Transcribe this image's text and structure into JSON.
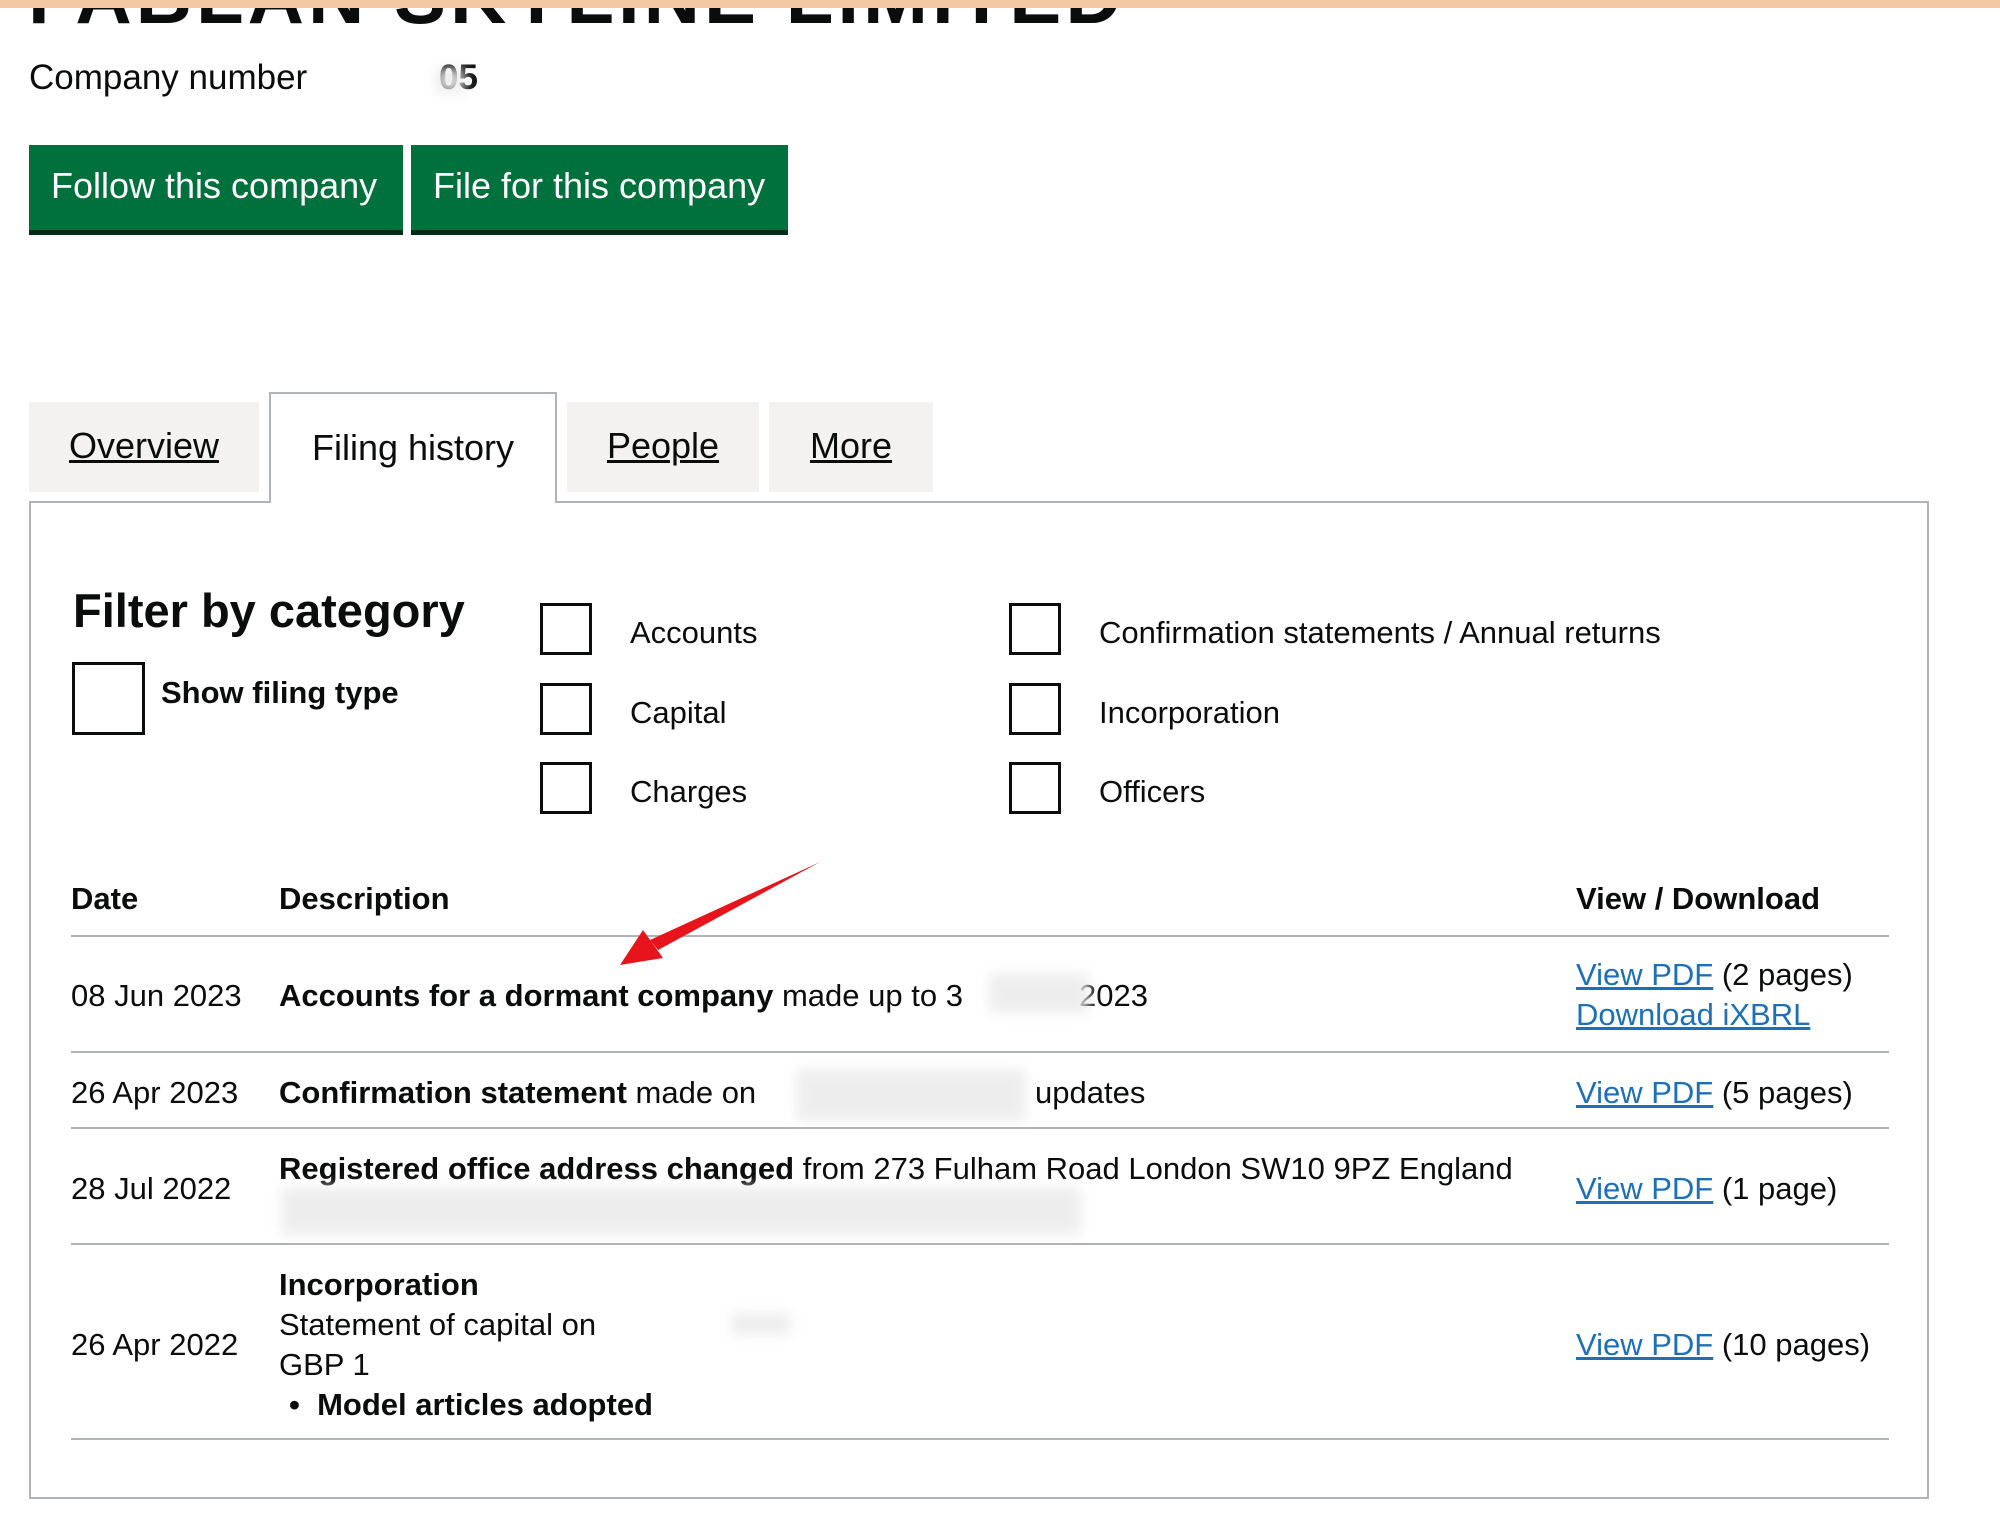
{
  "company": {
    "name": "FABLAN SKYLINE LIMITED",
    "number_label": "Company number",
    "number_value": "05"
  },
  "actions": {
    "follow_label": "Follow this company",
    "file_label": "File for this company"
  },
  "tabs": [
    {
      "label": "Overview"
    },
    {
      "label": "Filing history"
    },
    {
      "label": "People"
    },
    {
      "label": "More"
    }
  ],
  "filter": {
    "title": "Filter by category",
    "show_filing_type": "Show filing type",
    "categories": [
      "Accounts",
      "Capital",
      "Charges",
      "Confirmation statements / Annual returns",
      "Incorporation",
      "Officers"
    ]
  },
  "table": {
    "headers": {
      "date": "Date",
      "description": "Description",
      "view": "View / Download"
    },
    "rows": [
      {
        "date": "08 Jun 2023",
        "desc_bold": "Accounts for a dormant company",
        "desc_rest": " made up to 3",
        "desc_tail": "2023",
        "link1": "View PDF",
        "pages1": " (2 pages)",
        "link2": "Download iXBRL"
      },
      {
        "date": "26 Apr 2023",
        "desc_bold": "Confirmation statement",
        "desc_rest": " made on",
        "desc_tail": "updates",
        "link1": "View PDF",
        "pages1": " (5 pages)"
      },
      {
        "date": "28 Jul 2022",
        "desc_bold": "Registered office address changed",
        "desc_rest": " from 273 Fulham Road London SW10 9PZ England",
        "link1": "View PDF",
        "pages1": " (1 page)"
      },
      {
        "date": "26 Apr 2022",
        "desc_bold": "Incorporation",
        "line2": "Statement of capital on",
        "line3": "GBP 1",
        "bullet": "Model articles adopted",
        "link1": "View PDF",
        "pages1": " (10 pages)"
      }
    ]
  },
  "colors": {
    "button": "#00703c",
    "link": "#1d70b8",
    "arrow": "#e8141b"
  }
}
